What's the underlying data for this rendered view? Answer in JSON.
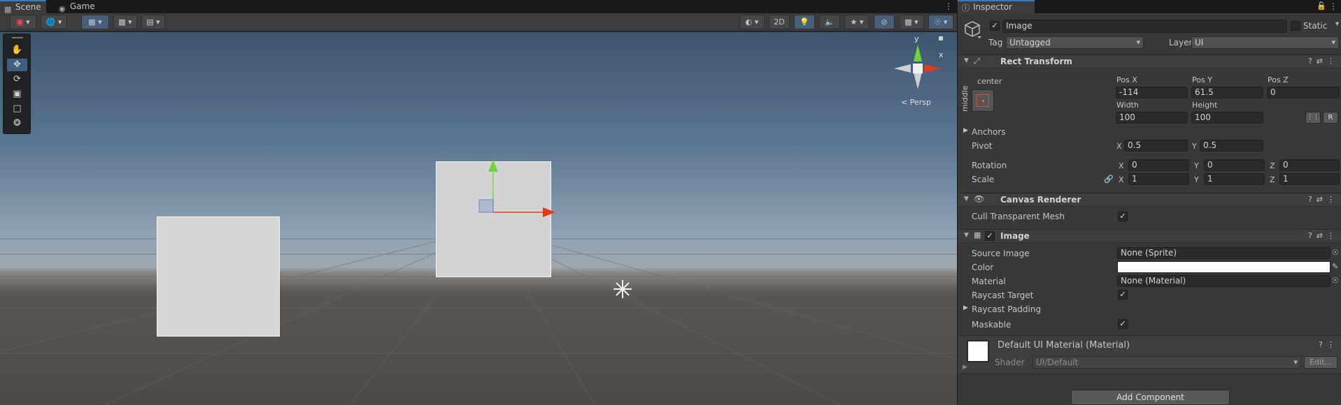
{
  "scene_panel": {
    "tabs": [
      {
        "label": "Scene",
        "icon": "grid-icon"
      },
      {
        "label": "Game",
        "icon": "gamepad-icon"
      }
    ],
    "more_menu": "⋮",
    "toolbar": {
      "toggle_2d": "2D"
    },
    "gizmo": {
      "y_label": "y",
      "x_label": "x",
      "projection": "Persp"
    },
    "tools": [
      "hand-tool",
      "move-tool",
      "rotate-tool",
      "scale-tool",
      "rect-tool",
      "transform-tool"
    ],
    "active_tool": "move-tool"
  },
  "inspector": {
    "tab_label": "Inspector",
    "object": {
      "name": "Image",
      "active": true,
      "static_label": "Static",
      "tag_label": "Tag",
      "tag_value": "Untagged",
      "layer_label": "Layer",
      "layer_value": "UI"
    },
    "rect_transform": {
      "title": "Rect Transform",
      "anchor_h": "center",
      "anchor_v": "middle",
      "pos_x_label": "Pos X",
      "pos_x": "-114",
      "pos_y_label": "Pos Y",
      "pos_y": "61.5",
      "pos_z_label": "Pos Z",
      "pos_z": "0",
      "width_label": "Width",
      "width": "100",
      "height_label": "Height",
      "height": "100",
      "r_button": "R",
      "anchors_label": "Anchors",
      "pivot_label": "Pivot",
      "pivot_x": "0.5",
      "pivot_y": "0.5",
      "rotation_label": "Rotation",
      "rot_x": "0",
      "rot_y": "0",
      "rot_z": "0",
      "scale_label": "Scale",
      "scale_x": "1",
      "scale_y": "1",
      "scale_z": "1",
      "axis_x": "X",
      "axis_y": "Y",
      "axis_z": "Z"
    },
    "canvas_renderer": {
      "title": "Canvas Renderer",
      "cull_label": "Cull Transparent Mesh",
      "cull": true
    },
    "image": {
      "title": "Image",
      "enabled": true,
      "source_label": "Source Image",
      "source_value": "None (Sprite)",
      "color_label": "Color",
      "color_value": "#ffffff",
      "material_label": "Material",
      "material_value": "None (Material)",
      "raycast_label": "Raycast Target",
      "raycast": true,
      "padding_label": "Raycast Padding",
      "maskable_label": "Maskable",
      "maskable": true
    },
    "material": {
      "title": "Default UI Material (Material)",
      "shader_label": "Shader",
      "shader_value": "UI/Default",
      "edit_button": "Edit..."
    },
    "add_component": "Add Component"
  }
}
